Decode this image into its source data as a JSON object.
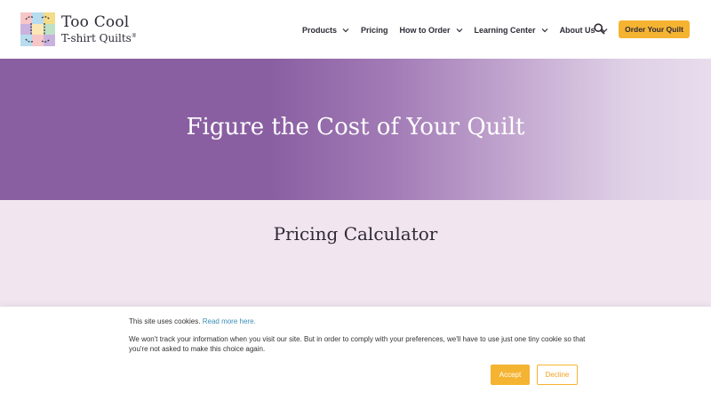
{
  "header": {
    "logo": {
      "line1": "Too Cool",
      "line2": "T-shirt Quilts",
      "trademark": "®"
    },
    "nav": [
      {
        "label": "Products",
        "has_dropdown": true
      },
      {
        "label": "Pricing",
        "has_dropdown": false
      },
      {
        "label": "How to Order",
        "has_dropdown": true
      },
      {
        "label": "Learning Center",
        "has_dropdown": true
      },
      {
        "label": "About Us",
        "has_dropdown": true
      }
    ],
    "search_icon": "search-icon",
    "order_button": "Order Your Quilt"
  },
  "hero": {
    "title": "Figure the Cost of Your Quilt"
  },
  "pricing": {
    "title": "Pricing Calculator"
  },
  "cookie": {
    "intro": "This site uses cookies.",
    "link": "Read more here.",
    "body": "We won't track your information when you visit our site. But in order to comply with your preferences, we'll have to use just one tiny cookie so that you're not asked to make this choice again.",
    "accept": "Accept",
    "decline": "Decline"
  },
  "colors": {
    "brand_purple": "#8a5fa2",
    "accent_yellow": "#f5b332",
    "pricing_bg": "#f1e6f0",
    "link": "#3a8fb7"
  }
}
